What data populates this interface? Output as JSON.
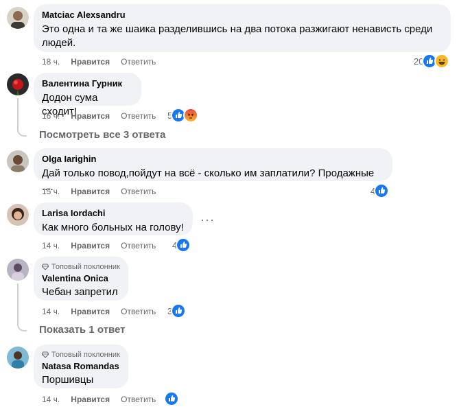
{
  "actions": {
    "like": "Нравится",
    "reply": "Ответить"
  },
  "comments": [
    {
      "author": "Matciac Alexsandru",
      "text_line1": "Это одна и та же шаика разделившись на два потока разжигают ненависть среди",
      "text_line2": "людей.",
      "time": "18 ч.",
      "reactions": "20",
      "reaction_icons": [
        "like-icon",
        "haha-icon"
      ]
    },
    {
      "author": "Валентина Гурник",
      "text": "Додон сума сходит!",
      "time": "16 ч.",
      "reactions": "5",
      "reaction_icons": [
        "like-icon",
        "angry-icon"
      ],
      "view_replies": "Посмотреть все 3 ответа"
    },
    {
      "author": "Olga Iarighin",
      "text": "Дай только повод,пойдут на всё - сколько им заплатили? Продажные ....",
      "time": "15 ч.",
      "reactions": "4",
      "reaction_icons": [
        "like-icon"
      ]
    },
    {
      "author": "Larisa Iordachi",
      "text": "Как много больных на голову!",
      "time": "14 ч.",
      "reactions": "4",
      "reaction_icons": [
        "like-icon"
      ],
      "more": "···"
    },
    {
      "badge": "Топовый поклонник",
      "author": "Valentina Onica",
      "text": "Чебан запретил",
      "time": "14 ч.",
      "reactions": "3",
      "reaction_icons": [
        "like-icon"
      ],
      "view_replies": "Показать 1 ответ"
    },
    {
      "badge": "Топовый поклонник",
      "author": "Natasa Romandas",
      "text": "Поршивцы",
      "time": "14 ч.",
      "reactions": "",
      "reaction_icons": [
        "like-icon"
      ]
    }
  ],
  "colors": {
    "bubble": "#f0f2f5",
    "like": "#1877f2",
    "haha": "#f7b928",
    "angry": "#e9710f",
    "meta": "#65676b"
  }
}
